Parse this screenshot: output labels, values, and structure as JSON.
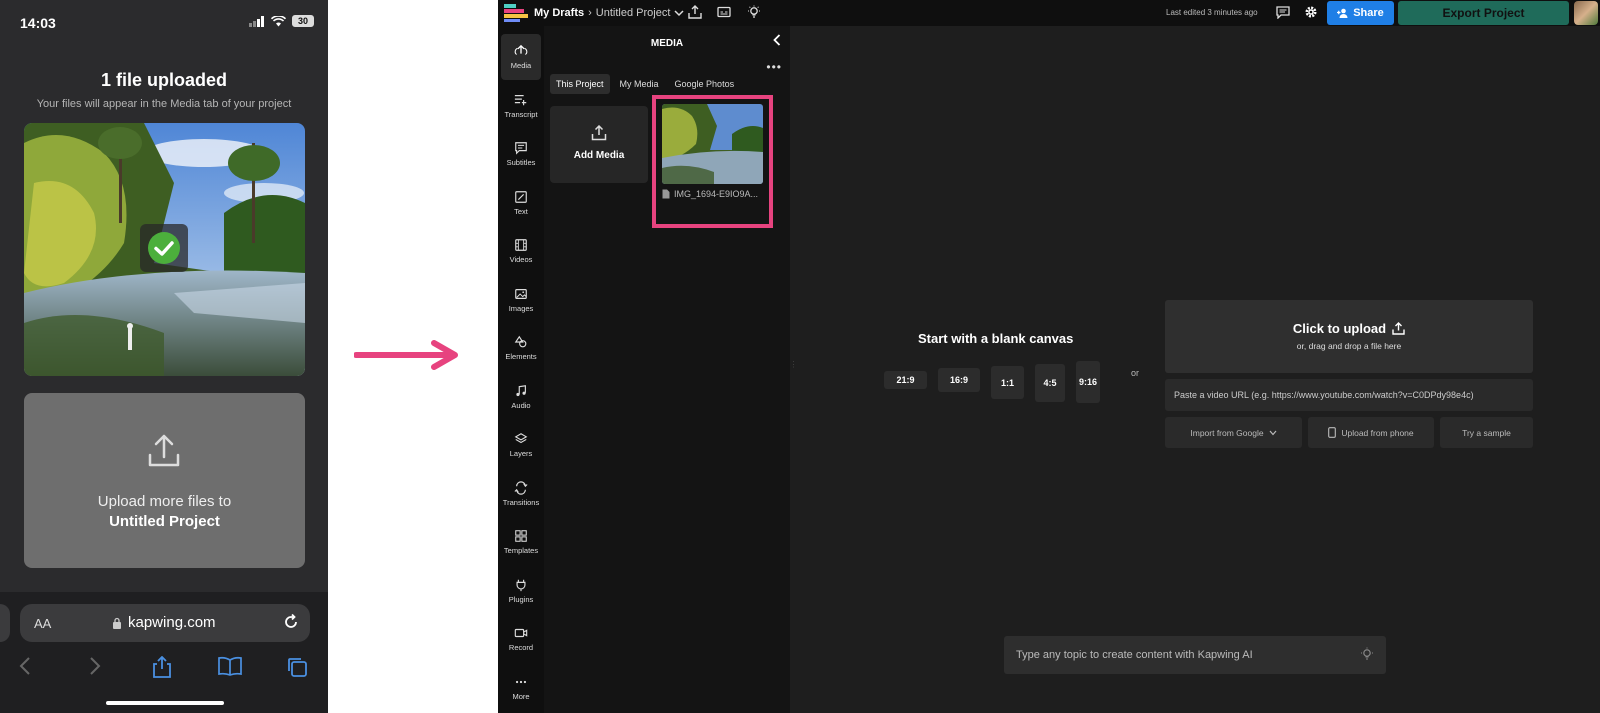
{
  "phone": {
    "status": {
      "time": "14:03",
      "battery": "30"
    },
    "title": "1 file uploaded",
    "subtitle": "Your files will appear in the Media tab of your project",
    "upload_more": {
      "line1": "Upload more files to",
      "line2": "Untitled Project"
    },
    "browser": {
      "aa_label": "AA",
      "url": "kapwing.com"
    }
  },
  "app": {
    "topbar": {
      "breadcrumb_root": "My Drafts",
      "breadcrumb_sep": "›",
      "project_name": "Untitled Project",
      "last_edited": "Last edited 3 minutes ago",
      "share_label": "Share",
      "export_label": "Export Project"
    },
    "rail": {
      "items": [
        {
          "label": "Media",
          "icon": "upload-icon"
        },
        {
          "label": "Transcript",
          "icon": "transcript-icon"
        },
        {
          "label": "Subtitles",
          "icon": "subtitles-icon"
        },
        {
          "label": "Text",
          "icon": "text-icon"
        },
        {
          "label": "Videos",
          "icon": "film-icon"
        },
        {
          "label": "Images",
          "icon": "image-icon"
        },
        {
          "label": "Elements",
          "icon": "shapes-icon"
        },
        {
          "label": "Audio",
          "icon": "music-icon"
        },
        {
          "label": "Layers",
          "icon": "layers-icon"
        },
        {
          "label": "Transitions",
          "icon": "transitions-icon"
        },
        {
          "label": "Templates",
          "icon": "grid-icon"
        },
        {
          "label": "Plugins",
          "icon": "plug-icon"
        },
        {
          "label": "Record",
          "icon": "camera-icon"
        },
        {
          "label": "More",
          "icon": "ellipsis-icon"
        }
      ]
    },
    "media_panel": {
      "title": "MEDIA",
      "tabs": [
        "This Project",
        "My Media",
        "Google Photos"
      ],
      "add_media_label": "Add Media",
      "file_name": "IMG_1694-E9IO9A..."
    },
    "canvas": {
      "blank_title": "Start with a blank canvas",
      "ratios": [
        "21:9",
        "16:9",
        "1:1",
        "4:5",
        "9:16"
      ],
      "or_label": "or",
      "upload_title": "Click to upload",
      "upload_sub": "or, drag and drop a file here",
      "url_placeholder": "Paste a video URL (e.g. https://www.youtube.com/watch?v=C0DPdy98e4c)",
      "import_google": "Import from Google",
      "upload_phone": "Upload from phone",
      "try_sample": "Try a sample",
      "ai_placeholder": "Type any topic to create content with Kapwing AI"
    }
  },
  "colors": {
    "accent_pink": "#e7437f",
    "share_blue": "#1f7fe6",
    "export_green": "#1f6b5a",
    "check_green": "#4caf3c"
  }
}
